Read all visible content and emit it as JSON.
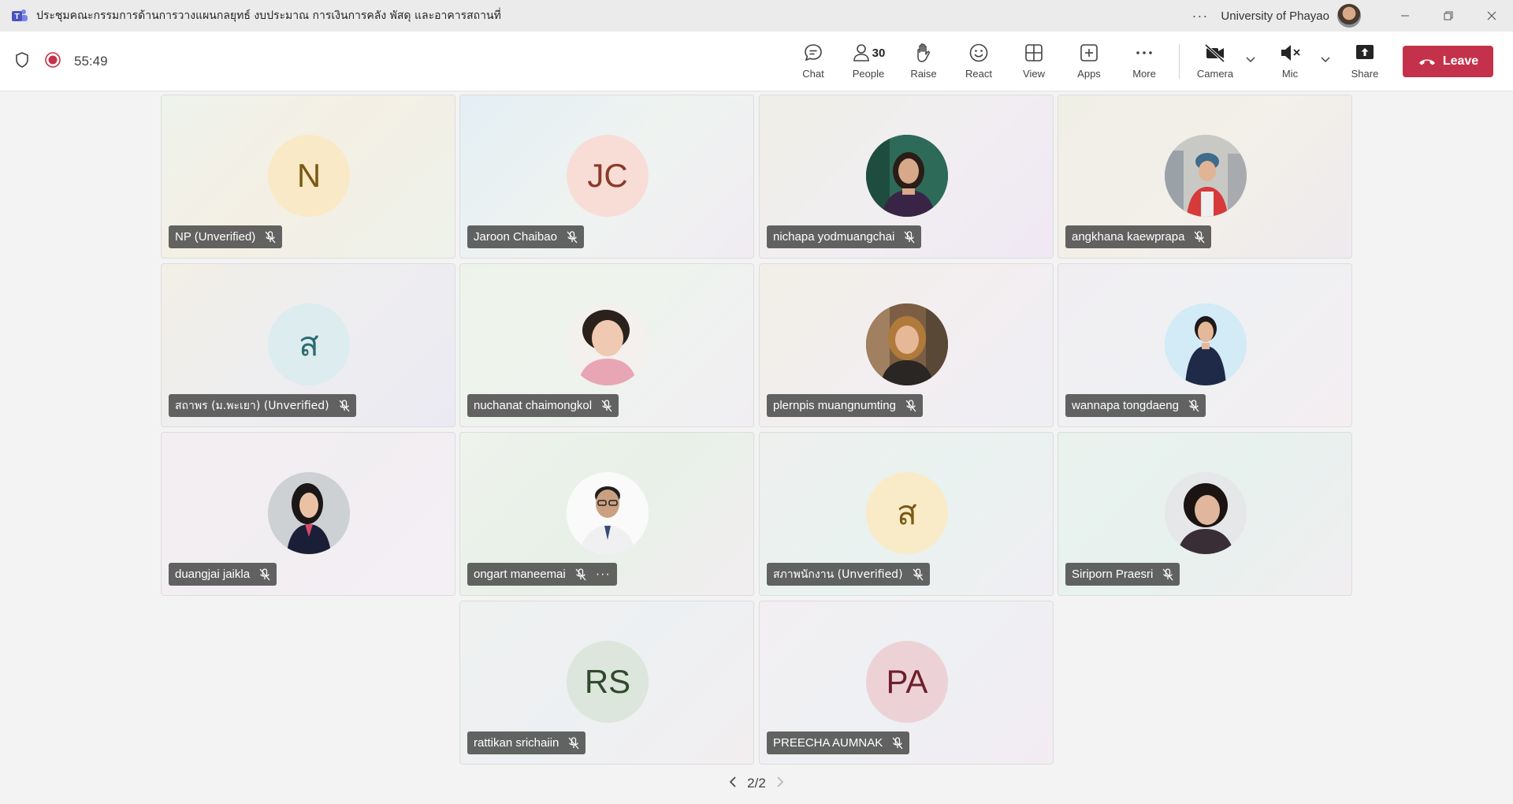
{
  "window": {
    "title": "ประชุมคณะกรรมการด้านการวางแผนกลยุทธ์ งบประมาณ การเงินการคลัง พัสดุ และอาคารสถานที่",
    "more_icon": "ellipsis-icon",
    "organization": "University of Phayao",
    "controls": [
      "minimize",
      "restore",
      "close"
    ]
  },
  "toolbar": {
    "timer": "55:49",
    "chat_label": "Chat",
    "people_label": "People",
    "people_count": "30",
    "raise_label": "Raise",
    "react_label": "React",
    "view_label": "View",
    "apps_label": "Apps",
    "more_label": "More",
    "camera_label": "Camera",
    "mic_label": "Mic",
    "share_label": "Share",
    "leave_label": "Leave",
    "leave_color": "#c4314b"
  },
  "participants": [
    {
      "name": "NP (Unverified)",
      "initials": "N",
      "avatar": "initials",
      "avatar_bg": "#f9e9c7",
      "avatar_fg": "#7a5a12",
      "muted": true
    },
    {
      "name": "Jaroon Chaibao",
      "initials": "JC",
      "avatar": "initials",
      "avatar_bg": "#f8ddd6",
      "avatar_fg": "#8a3a2a",
      "muted": true
    },
    {
      "name": "nichapa yodmuangchai",
      "avatar": "photo",
      "muted": true
    },
    {
      "name": "angkhana kaewprapa",
      "avatar": "photo",
      "muted": true
    },
    {
      "name": "สถาพร (ม.พะเยา) (Unverified)",
      "initials": "ส",
      "avatar": "initials",
      "avatar_bg": "#dcecef",
      "avatar_fg": "#2d6b72",
      "muted": true
    },
    {
      "name": "nuchanat chaimongkol",
      "avatar": "photo",
      "muted": true
    },
    {
      "name": "plernpis muangnumting",
      "avatar": "photo",
      "muted": true
    },
    {
      "name": "wannapa tongdaeng",
      "avatar": "photo",
      "muted": true
    },
    {
      "name": "duangjai jaikla",
      "avatar": "photo",
      "muted": true
    },
    {
      "name": "ongart maneemai",
      "avatar": "photo",
      "muted": true,
      "has_more": true
    },
    {
      "name": "สภาพนักงาน (Unverified)",
      "initials": "ส",
      "avatar": "initials",
      "avatar_bg": "#f9ebc8",
      "avatar_fg": "#7a5a12",
      "muted": true
    },
    {
      "name": "Siriporn Praesri",
      "avatar": "photo",
      "muted": true
    },
    {
      "name": "rattikan srichaiin",
      "initials": "RS",
      "avatar": "initials",
      "avatar_bg": "#dde6dc",
      "avatar_fg": "#2f4a2c",
      "muted": true
    },
    {
      "name": "PREECHA AUMNAK",
      "initials": "PA",
      "avatar": "initials",
      "avatar_bg": "#ecd2d6",
      "avatar_fg": "#6e1f2c",
      "muted": true
    }
  ],
  "pager": {
    "label": "2/2"
  }
}
